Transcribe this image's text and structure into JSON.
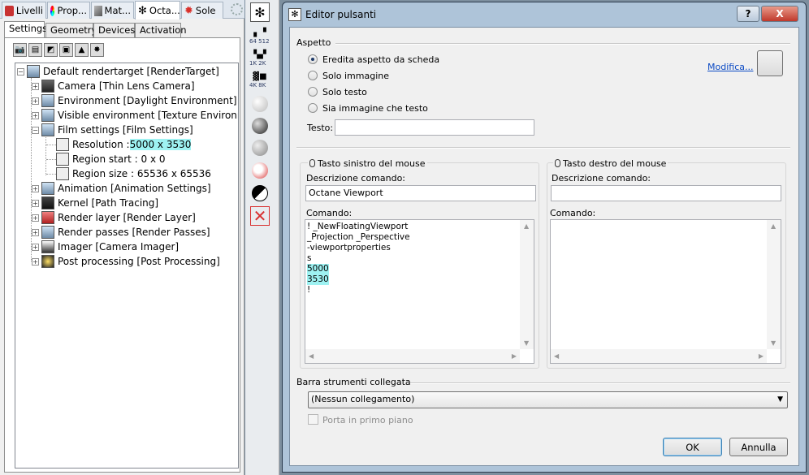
{
  "top_tabs": [
    {
      "label": "Livelli",
      "icon": "layers-icon",
      "color": "#c83232"
    },
    {
      "label": "Prop...",
      "icon": "properties-icon",
      "color": "#7a4fb0"
    },
    {
      "label": "Mat...",
      "icon": "materials-icon",
      "color": "#888888"
    },
    {
      "label": "Octa...",
      "icon": "octane-icon",
      "color": "#333333"
    },
    {
      "label": "Sole",
      "icon": "sun-icon",
      "color": "#d9302a"
    }
  ],
  "sub_tabs": [
    "Settings",
    "Geometry",
    "Devices",
    "Activation"
  ],
  "tree": {
    "root": "Default rendertarget  [RenderTarget]",
    "items": [
      {
        "label": "Camera  [Thin Lens Camera]"
      },
      {
        "label": "Environment  [Daylight Environment]"
      },
      {
        "label": "Visible environment  [Texture Environm"
      },
      {
        "label": "Film settings  [Film Settings]"
      },
      {
        "label": "Animation  [Animation Settings]"
      },
      {
        "label": "Kernel  [Path Tracing]"
      },
      {
        "label": "Render layer  [Render Layer]"
      },
      {
        "label": "Render passes  [Render Passes]"
      },
      {
        "label": "Imager  [Camera Imager]"
      },
      {
        "label": "Post processing  [Post Processing]"
      }
    ],
    "film_children": [
      {
        "label": "Resolution : ",
        "value": "5000 x 3530"
      },
      {
        "label": "Region start : 0 x 0"
      },
      {
        "label": "Region size : 65536 x 65536"
      }
    ]
  },
  "toolbar": {
    "labels_1": [
      "64",
      "512"
    ],
    "labels_2": [
      "1K",
      "2K"
    ],
    "labels_3": [
      "4K",
      "8K"
    ]
  },
  "dialog": {
    "title": "Editor pulsanti",
    "help_btn": "?",
    "close_btn": "X",
    "appearance": {
      "section": "Aspetto",
      "options": [
        "Eredita aspetto da scheda",
        "Solo immagine",
        "Solo testo",
        "Sia immagine che testo"
      ],
      "selected": 0,
      "modify_link": "Modifica...",
      "text_label": "Testo:",
      "text_value": ""
    },
    "left_mouse": {
      "title": "Tasto sinistro del mouse",
      "desc_label": "Descrizione comando:",
      "desc_value": "Octane Viewport",
      "cmd_label": "Comando:",
      "cmd_lines": [
        "! _NewFloatingViewport",
        "_Projection _Perspective",
        "-viewportproperties",
        "s",
        "5000",
        "3530",
        "!"
      ]
    },
    "right_mouse": {
      "title": "Tasto destro del mouse",
      "desc_label": "Descrizione comando:",
      "desc_value": "",
      "cmd_label": "Comando:"
    },
    "linked_toolbar": {
      "section": "Barra strumenti collegata",
      "selected": "(Nessun collegamento)",
      "checkbox_label": "Porta in primo piano"
    },
    "ok": "OK",
    "cancel": "Annulla"
  }
}
